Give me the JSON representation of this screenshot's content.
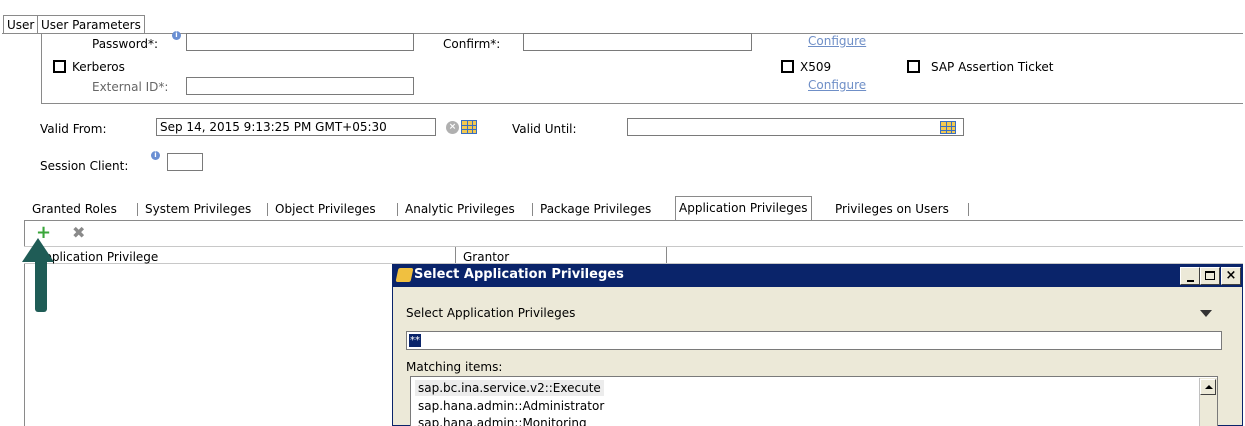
{
  "user_tabs": {
    "user": "User",
    "user_parameters": "User Parameters"
  },
  "auth": {
    "password_label": "Password*:",
    "confirm_label": "Confirm*:",
    "configure_link": "Configure",
    "kerberos_label": "Kerberos",
    "external_id_label": "External ID*:",
    "x509_label": "X509",
    "configure_link_2": "Configure",
    "sap_ticket_label": "SAP Assertion Ticket"
  },
  "validity": {
    "valid_from_label": "Valid From:",
    "valid_from_value": "Sep 14, 2015 9:13:25 PM GMT+05:30",
    "valid_until_label": "Valid Until:",
    "valid_until_value": "",
    "session_client_label": "Session Client:"
  },
  "privilege_tabs": [
    "Granted Roles",
    "System Privileges",
    "Object Privileges",
    "Analytic Privileges",
    "Package Privileges",
    "Application Privileges",
    "Privileges on Users"
  ],
  "table": {
    "col_privilege": "Application Privilege",
    "col_grantor": "Grantor"
  },
  "dialog": {
    "title": "Select Application Privileges",
    "section_label": "Select Application Privileges",
    "filter_value": "**",
    "matching_label": "Matching items:",
    "items": [
      "sap.bc.ina.service.v2::Execute",
      "sap.hana.admin::Administrator",
      "sap.hana.admin::Monitoring"
    ]
  },
  "colors": {
    "dialog_title_bg": "#0a246a",
    "selected_item_bg": "#ececec",
    "arrow": "#1f5c56",
    "add_icon": "#3aa63a"
  }
}
